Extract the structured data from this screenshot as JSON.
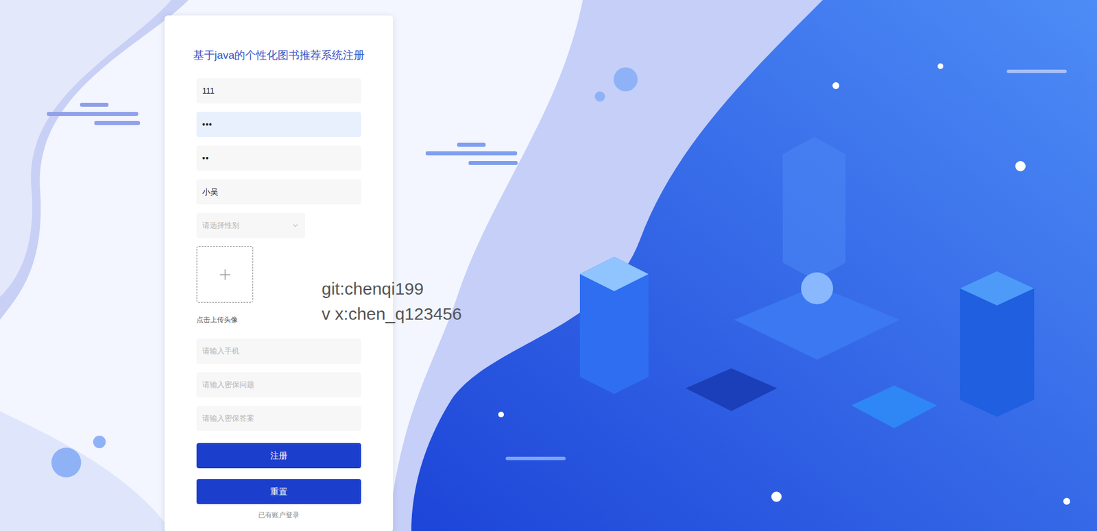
{
  "page": {
    "title": "基于java的个性化图书推荐系统注册"
  },
  "fields": [
    {
      "value": "111",
      "kind": "text",
      "highlighted": false
    },
    {
      "value": "•••",
      "kind": "password",
      "highlighted": true
    },
    {
      "value": "••",
      "kind": "password",
      "highlighted": false
    },
    {
      "value": "小吴",
      "kind": "text",
      "highlighted": false
    }
  ],
  "gender": {
    "placeholder": "请选择性别"
  },
  "avatar": {
    "label": "点击上传头像"
  },
  "more_fields": [
    {
      "placeholder": "请输入手机"
    },
    {
      "placeholder": "请输入密保问题"
    },
    {
      "placeholder": "请输入密保答案"
    }
  ],
  "buttons": [
    {
      "label": "注册"
    },
    {
      "label": "重置"
    }
  ],
  "login_link": "已有账户登录",
  "watermark": [
    "git:chenqi199",
    "v x:chen_q123456"
  ]
}
